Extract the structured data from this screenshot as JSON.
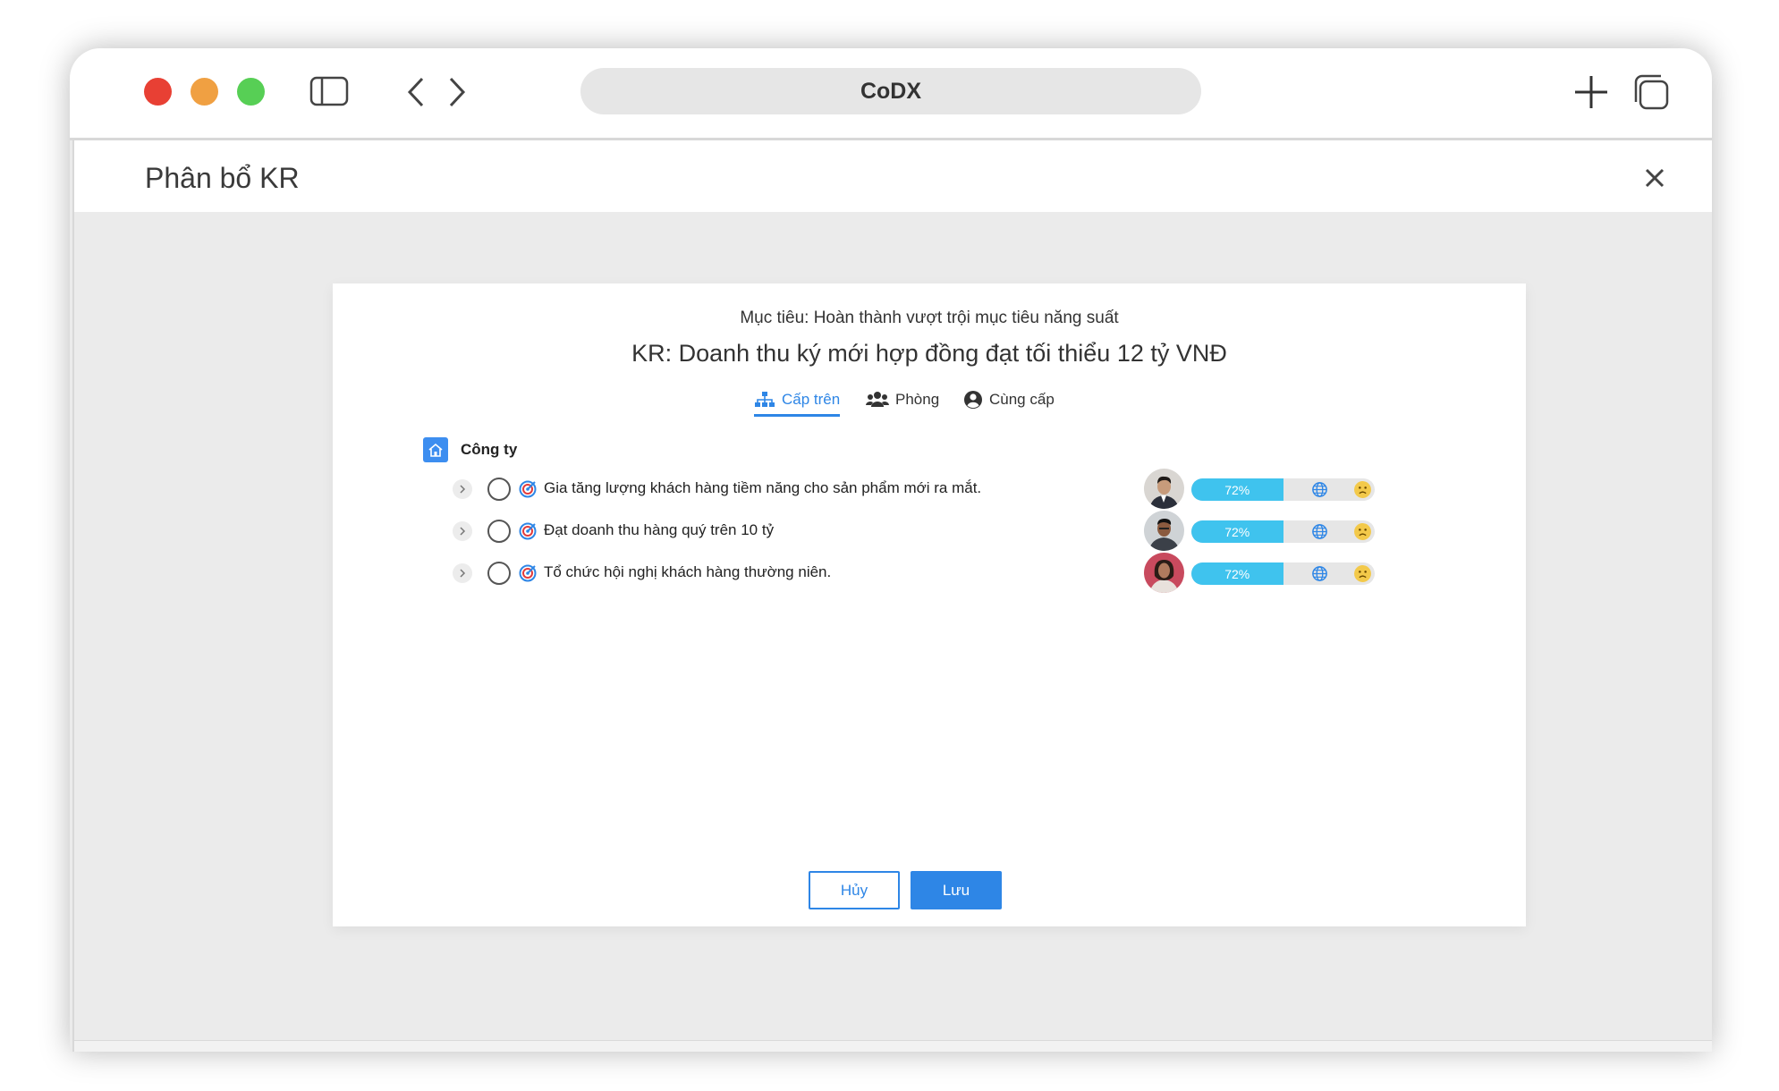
{
  "browser": {
    "address": "CoDX"
  },
  "header": {
    "title": "Phân bổ KR"
  },
  "dialog": {
    "objective": "Mục tiêu: Hoàn thành vượt trội mục tiêu năng suất",
    "kr_title": "KR: Doanh thu ký mới hợp đồng đạt tối thiểu 12 tỷ VNĐ",
    "tabs": [
      {
        "label": "Cấp trên",
        "active": true,
        "icon": "sitemap-icon"
      },
      {
        "label": "Phòng",
        "active": false,
        "icon": "users-icon"
      },
      {
        "label": "Cùng cấp",
        "active": false,
        "icon": "user-circle-icon"
      }
    ],
    "section": {
      "label": "Công ty",
      "icon": "home-icon"
    },
    "rows": [
      {
        "text": "Gia tăng lượng khách hàng tiềm năng cho sản phẩm mới ra mắt.",
        "progress_label": "72%",
        "progress": 0.5,
        "avatar": "man-suit"
      },
      {
        "text": "Đạt doanh thu hàng quý trên 10 tỷ",
        "progress_label": "72%",
        "progress": 0.5,
        "avatar": "man-casual"
      },
      {
        "text": "Tổ chức hội nghị khách hàng thường niên.",
        "progress_label": "72%",
        "progress": 0.5,
        "avatar": "woman"
      }
    ],
    "buttons": {
      "cancel": "Hủy",
      "save": "Lưu"
    }
  },
  "colors": {
    "accent": "#2e86e6",
    "progress": "#3fc3ee",
    "mood": "#f3c94a"
  }
}
